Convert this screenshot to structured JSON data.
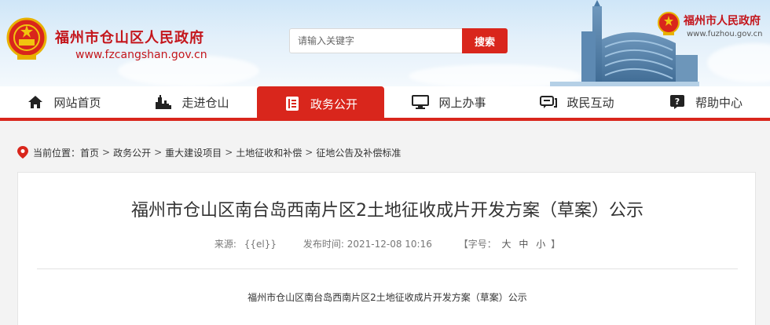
{
  "header": {
    "site_title": "福州市仓山区人民政府",
    "site_url": "www.fzcangshan.gov.cn",
    "search_placeholder": "请输入关键字",
    "search_button": "搜索",
    "right_title": "福州市人民政府",
    "right_url": "www.fuzhou.gov.cn"
  },
  "nav": {
    "items": [
      {
        "label": "网站首页",
        "icon": "home-icon"
      },
      {
        "label": "走进仓山",
        "icon": "city-icon"
      },
      {
        "label": "政务公开",
        "icon": "document-icon",
        "active": true
      },
      {
        "label": "网上办事",
        "icon": "monitor-icon"
      },
      {
        "label": "政民互动",
        "icon": "chat-icon"
      },
      {
        "label": "帮助中心",
        "icon": "help-icon"
      }
    ]
  },
  "breadcrumb": {
    "prefix": "当前位置：",
    "items": [
      "首页",
      "政务公开",
      "重大建设项目",
      "土地征收和补偿",
      "征地公告及补偿标准"
    ],
    "separator": ">"
  },
  "article": {
    "title": "福州市仓山区南台岛西南片区2土地征收成片开发方案（草案）公示",
    "source_label": "来源:",
    "source_value": "{{el}}",
    "date_label": "发布时间:",
    "date_value": "2021-12-08 10:16",
    "font_size_label": "【字号：",
    "font_large": "大",
    "font_medium": "中",
    "font_small": "小",
    "font_size_end": "】",
    "body_title": "福州市仓山区南台岛西南片区2土地征收成片开发方案（草案）公示"
  },
  "colors": {
    "brand_red": "#d9261c",
    "title_red": "#c4161c"
  }
}
